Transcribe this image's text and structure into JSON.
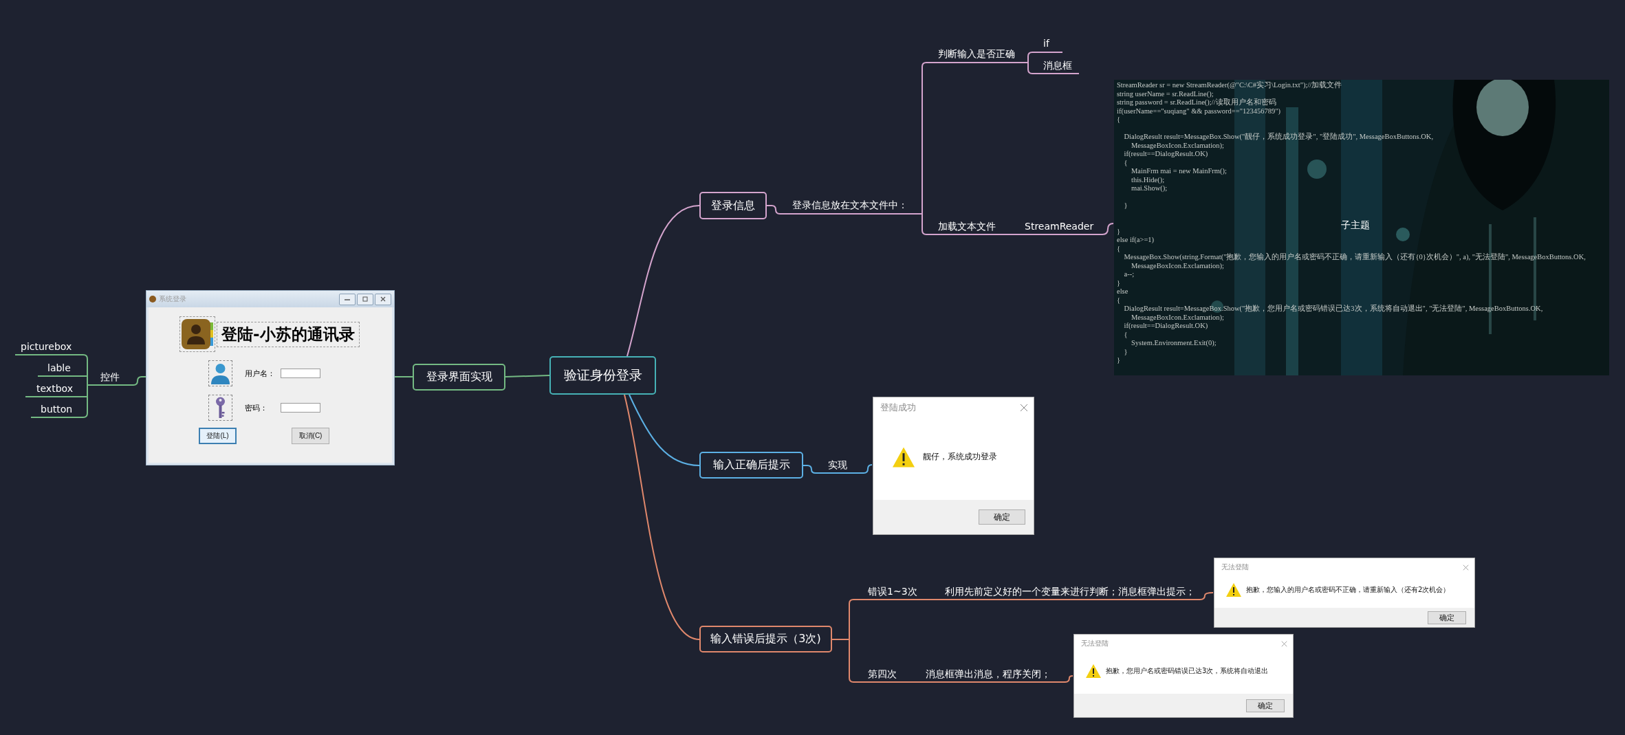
{
  "central_topic": {
    "label": "验证身份登录",
    "color": "#46b2b6"
  },
  "branches": [
    {
      "label": "登录界面实现",
      "color": "#74ba83",
      "subtopics": [
        {
          "label": "控件",
          "children": [
            {
              "label": "picturebox"
            },
            {
              "label": "lable"
            },
            {
              "label": "textbox"
            },
            {
              "label": "button"
            }
          ]
        }
      ],
      "login_window": {
        "title": "系统登录",
        "heading": "登陆-小苏的通讯录",
        "fields": [
          {
            "label": "用户名：",
            "kind": "user"
          },
          {
            "label": "密码：",
            "kind": "key"
          }
        ],
        "buttons": [
          {
            "label": "登陆(L)",
            "focused": true
          },
          {
            "label": "取消(C)",
            "focused": false
          }
        ]
      }
    },
    {
      "label": "登录信息",
      "color": "#d4a4cd",
      "subtopics": [
        {
          "label": "登录信息放在文本文件中：",
          "children": [
            {
              "label": "判断输入是否正确",
              "children": [
                {
                  "label": "if"
                },
                {
                  "label": "消息框"
                }
              ]
            },
            {
              "label": "加载文本文件",
              "children": [
                {
                  "label": "StreamReader"
                }
              ]
            }
          ]
        }
      ],
      "code_image": {
        "topic": "子主题",
        "lines": [
          {
            "kind": "code",
            "text": "StreamReader sr = new StreamReader(@\"C:\\C#实习\\Login.txt\");//加载文件"
          },
          {
            "kind": "code",
            "text": "string userName = sr.ReadLine();"
          },
          {
            "kind": "code",
            "text": "string password = sr.ReadLine();//读取用户名和密码"
          },
          {
            "kind": "code",
            "text": "if(userName==\"suqiang\" && password==\"123456789\")"
          },
          {
            "kind": "code",
            "text": "{"
          },
          {
            "kind": "blank"
          },
          {
            "kind": "code",
            "text": "    DialogResult result=MessageBox.Show(\"靓仔，系统成功登录\", \"登陆成功\", MessageBoxButtons.OK,"
          },
          {
            "kind": "code",
            "text": "        MessageBoxIcon.Exclamation);"
          },
          {
            "kind": "code",
            "text": "    if(result==DialogResult.OK)"
          },
          {
            "kind": "code",
            "text": "    {"
          },
          {
            "kind": "code",
            "text": "        MainFrm mai = new MainFrm();"
          },
          {
            "kind": "code",
            "text": "        this.Hide();"
          },
          {
            "kind": "code",
            "text": "        mai.Show();"
          },
          {
            "kind": "blank"
          },
          {
            "kind": "code",
            "text": "    }"
          },
          {
            "kind": "blank"
          },
          {
            "kind": "blank"
          },
          {
            "kind": "code",
            "text": "}"
          },
          {
            "kind": "code",
            "text": "else if(a>=1)"
          },
          {
            "kind": "code",
            "text": "{"
          },
          {
            "kind": "code",
            "text": "    MessageBox.Show(string.Format(\"抱歉，您输入的用户名或密码不正确，请重新输入（还有{0}次机会）\", a), \"无法登陆\", MessageBoxButtons.OK,"
          },
          {
            "kind": "code",
            "text": "        MessageBoxIcon.Exclamation);"
          },
          {
            "kind": "code",
            "text": "    a--;"
          },
          {
            "kind": "code",
            "text": "}"
          },
          {
            "kind": "code",
            "text": "else"
          },
          {
            "kind": "code",
            "text": "{"
          },
          {
            "kind": "code",
            "text": "    DialogResult result=MessageBox.Show(\"抱歉，您用户名或密码错误已达3次，系统将自动退出\", \"无法登陆\", MessageBoxButtons.OK,"
          },
          {
            "kind": "code",
            "text": "        MessageBoxIcon.Exclamation);"
          },
          {
            "kind": "code",
            "text": "    if(result==DialogResult.OK)"
          },
          {
            "kind": "code",
            "text": "    {"
          },
          {
            "kind": "code",
            "text": "        System.Environment.Exit(0);"
          },
          {
            "kind": "code",
            "text": "    }"
          },
          {
            "kind": "code",
            "text": "}"
          }
        ]
      }
    },
    {
      "label": "输入正确后提示",
      "color": "#5cb0e4",
      "subtopics": [
        {
          "label": "实现"
        }
      ],
      "dialogs": [
        {
          "title": "登陆成功",
          "message": "靓仔，系统成功登录",
          "button": "确定"
        }
      ]
    },
    {
      "label": "输入错误后提示（3次)",
      "color": "#e0886c",
      "subtopics": [
        {
          "label": "错误1~3次",
          "children": [
            {
              "label": "利用先前定义好的一个变量来进行判断；消息框弹出提示；"
            }
          ]
        },
        {
          "label": "第四次",
          "children": [
            {
              "label": "消息框弹出消息，程序关闭；"
            }
          ]
        }
      ],
      "dialogs": [
        {
          "title": "无法登陆",
          "message": "抱歉，您输入的用户名或密码不正确，请重新输入（还有2次机会）",
          "button": "确定"
        },
        {
          "title": "无法登陆",
          "message": "抱歉，您用户名或密码错误已达3次，系统将自动退出",
          "button": "确定"
        }
      ]
    }
  ]
}
